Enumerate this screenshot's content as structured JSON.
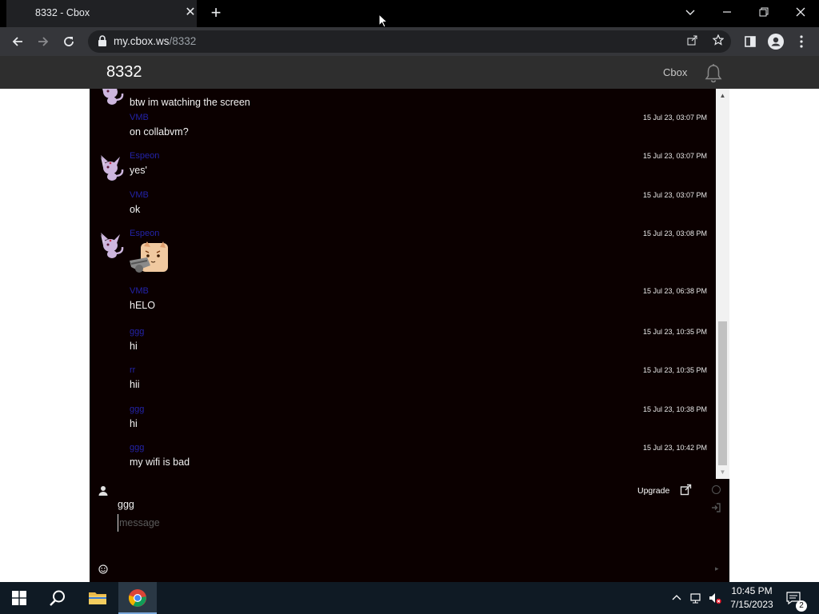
{
  "browser": {
    "tab_title": "8332 - Cbox",
    "tab_close": "✕",
    "new_tab": "+",
    "url_host": "my.cbox.ws",
    "url_path": "/8332"
  },
  "cbox": {
    "room_title": "8332",
    "brand_link": "Cbox"
  },
  "messages": [
    {
      "user": "",
      "text": "btw im watching the screen",
      "time": "",
      "avatar": true,
      "sticker": false
    },
    {
      "user": "VMB",
      "text": "on collabvm?",
      "time": "15 Jul 23, 03:07 PM",
      "avatar": false,
      "sticker": false
    },
    {
      "user": "Espeon",
      "text": "yes'",
      "time": "15 Jul 23, 03:07 PM",
      "avatar": true,
      "sticker": false
    },
    {
      "user": "VMB",
      "text": "ok",
      "time": "15 Jul 23, 03:07 PM",
      "avatar": false,
      "sticker": false
    },
    {
      "user": "Espeon",
      "text": "",
      "time": "15 Jul 23, 03:08 PM",
      "avatar": true,
      "sticker": true
    },
    {
      "user": "VMB",
      "text": "hELO",
      "time": "15 Jul 23, 06:38 PM",
      "avatar": false,
      "sticker": false
    },
    {
      "user": "ggg",
      "text": "hi",
      "time": "15 Jul 23, 10:35 PM",
      "avatar": false,
      "sticker": false
    },
    {
      "user": "rr",
      "text": "hii",
      "time": "15 Jul 23, 10:35 PM",
      "avatar": false,
      "sticker": false
    },
    {
      "user": "ggg",
      "text": "hi",
      "time": "15 Jul 23, 10:38 PM",
      "avatar": false,
      "sticker": false
    },
    {
      "user": "ggg",
      "text": "my wifi is bad",
      "time": "15 Jul 23, 10:42 PM",
      "avatar": false,
      "sticker": false
    }
  ],
  "form": {
    "upgrade_label": "Upgrade",
    "name_value": "ggg",
    "message_placeholder": "message"
  },
  "taskbar": {
    "time": "10:45 PM",
    "date": "7/15/2023",
    "notification_count": "2"
  },
  "colors": {
    "chat_background": "#0b0000",
    "username": "#2323a8",
    "header": "#2e2e2e"
  }
}
